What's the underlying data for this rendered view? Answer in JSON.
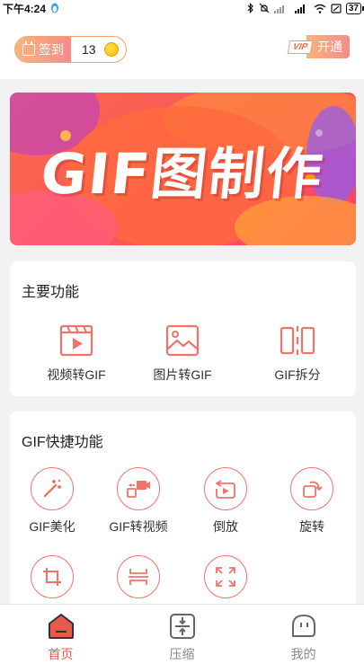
{
  "status_bar": {
    "time": "下午4:24",
    "battery": "37"
  },
  "header": {
    "checkin_label": "签到",
    "checkin_count": "13",
    "vip_badge": "VIP",
    "vip_open": "开通"
  },
  "banner": {
    "title": "GIF图制作"
  },
  "main_functions": {
    "title": "主要功能",
    "items": [
      {
        "label": "视频转GIF",
        "icon": "video-icon"
      },
      {
        "label": "图片转GIF",
        "icon": "image-icon"
      },
      {
        "label": "GIF拆分",
        "icon": "split-icon"
      }
    ]
  },
  "quick_functions": {
    "title": "GIF快捷功能",
    "items": [
      {
        "label": "GIF美化",
        "icon": "magic-wand-icon"
      },
      {
        "label": "GIF转视频",
        "icon": "gif-to-video-icon"
      },
      {
        "label": "倒放",
        "icon": "reverse-play-icon"
      },
      {
        "label": "旋转",
        "icon": "rotate-icon"
      },
      {
        "label": "",
        "icon": "crop-icon"
      },
      {
        "label": "",
        "icon": "compress-icon"
      },
      {
        "label": "",
        "icon": "resize-icon"
      }
    ]
  },
  "bottom_nav": {
    "items": [
      {
        "label": "首页",
        "icon": "home-icon",
        "active": true
      },
      {
        "label": "压缩",
        "icon": "compress-nav-icon",
        "active": false
      },
      {
        "label": "我的",
        "icon": "profile-icon",
        "active": false
      }
    ]
  },
  "colors": {
    "accent": "#f0736a",
    "active": "#e8584f",
    "background": "#f2f2f2"
  }
}
